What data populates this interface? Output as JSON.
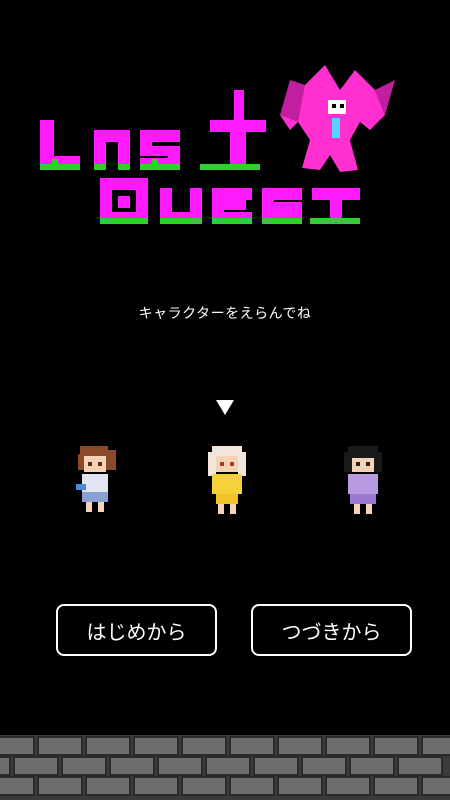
{
  "title": {
    "line1": "LAST",
    "line2": "QUEST",
    "colors": {
      "primary": "#ff1aff",
      "grass": "#33cc33",
      "monster": "#ff2fd0"
    }
  },
  "subtitle": "キャラクターをえらんでね",
  "characters": [
    {
      "name_icon": "brown-hair-girl-icon",
      "selected": false
    },
    {
      "name_icon": "white-hair-girl-icon",
      "selected": true
    },
    {
      "name_icon": "black-hair-girl-icon",
      "selected": false
    }
  ],
  "buttons": {
    "new_game": "はじめから",
    "continue": "つづきから"
  }
}
